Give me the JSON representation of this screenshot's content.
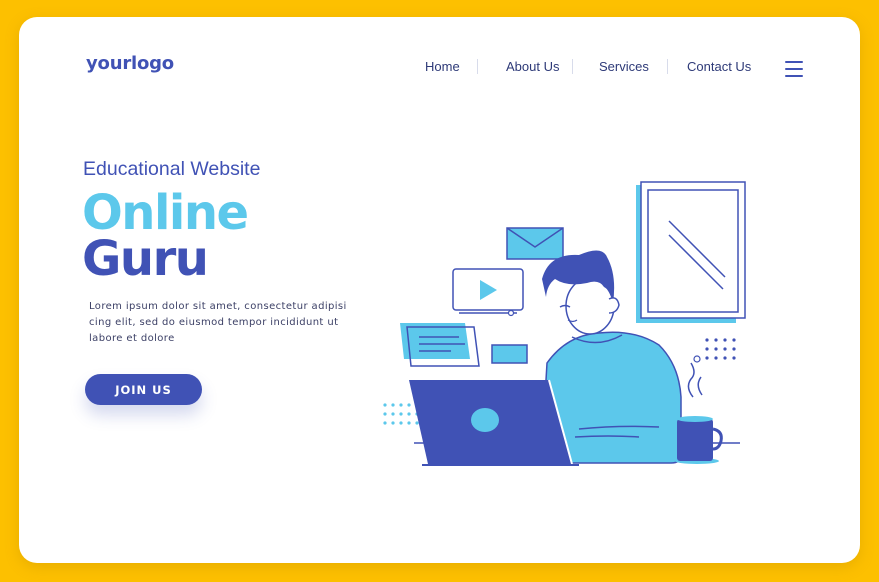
{
  "brand": {
    "logo_text": "yourlogo"
  },
  "nav": {
    "items": [
      "Home",
      "About Us",
      "Services",
      "Contact Us"
    ]
  },
  "hero": {
    "eyebrow": "Educational Website",
    "title_line1": "Online",
    "title_line2": "Guru",
    "description": "Lorem ipsum dolor sit amet, consectetur adipisi cing elit, sed do eiusmod tempor incididunt ut labore et dolore",
    "cta_label": "JOIN US"
  },
  "icons": [
    "menu-icon",
    "mail-icon",
    "video-player-icon",
    "chat-window-icon",
    "laptop-icon",
    "coffee-mug-icon",
    "window-icon"
  ],
  "colors": {
    "background": "#FDC000",
    "card": "#FFFFFF",
    "primary": "#4052B5",
    "accent": "#5CC8EB",
    "text": "#3C4066"
  }
}
